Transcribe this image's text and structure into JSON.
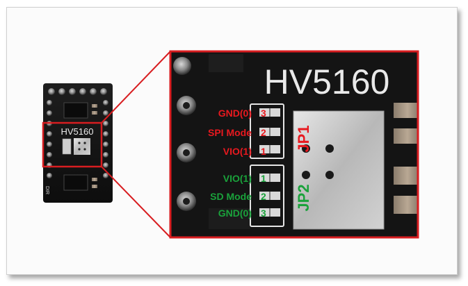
{
  "board": {
    "chip_label": "HV5160",
    "side_label": "DIR"
  },
  "zoom": {
    "title": "HV5160",
    "jumper_1": {
      "name": "JP1",
      "color": "#e8191f",
      "rows": [
        {
          "label": "GND(0)",
          "pin": "3"
        },
        {
          "label": "SPI Mode",
          "pin": "2"
        },
        {
          "label": "VIO(1)",
          "pin": "1"
        }
      ]
    },
    "jumper_2": {
      "name": "JP2",
      "color": "#1aa23b",
      "rows": [
        {
          "label": "VIO(1)",
          "pin": "1"
        },
        {
          "label": "SD Mode",
          "pin": "2"
        },
        {
          "label": "GND(0)",
          "pin": "3"
        }
      ]
    }
  },
  "colors": {
    "highlight_border": "#d81d20",
    "pcb_black": "#1a1a1a",
    "silkscreen": "#e9e9e9"
  }
}
